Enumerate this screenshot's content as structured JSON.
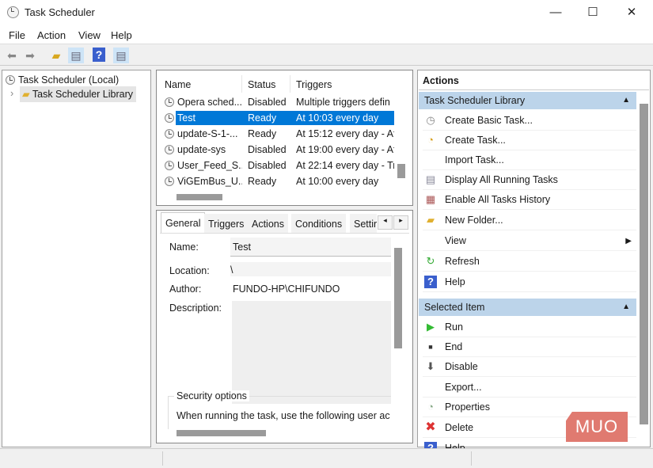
{
  "window": {
    "title": "Task Scheduler",
    "minimize": "—",
    "maximize": "☐",
    "close": "✕"
  },
  "menu": [
    "File",
    "Action",
    "View",
    "Help"
  ],
  "toolbar": [
    "back-icon",
    "forward-icon",
    "folder-up-icon",
    "show-hide-console-tree-icon",
    "help-icon",
    "show-hide-action-pane-icon"
  ],
  "tree": {
    "root": "Task Scheduler (Local)",
    "child": "Task Scheduler Library",
    "expander": "›"
  },
  "tasks": {
    "columns": [
      "Name",
      "Status",
      "Triggers"
    ],
    "rows": [
      {
        "name": "Opera sched...",
        "status": "Disabled",
        "trigger": "Multiple triggers defin"
      },
      {
        "name": "Test",
        "status": "Ready",
        "trigger": "At 10:03 every day",
        "selected": true
      },
      {
        "name": "update-S-1-...",
        "status": "Ready",
        "trigger": "At 15:12 every day - Aft"
      },
      {
        "name": "update-sys",
        "status": "Disabled",
        "trigger": "At 19:00 every day - Aft"
      },
      {
        "name": "User_Feed_S...",
        "status": "Disabled",
        "trigger": "At 22:14 every day - Trig"
      },
      {
        "name": "ViGEmBus_U...",
        "status": "Ready",
        "trigger": "At 10:00 every day"
      }
    ]
  },
  "details": {
    "tabs": [
      "General",
      "Triggers",
      "Actions",
      "Conditions",
      "Settir"
    ],
    "active_tab": "General",
    "name_label": "Name:",
    "name_value": "Test",
    "location_label": "Location:",
    "location_value": "\\",
    "author_label": "Author:",
    "author_value": "FUNDO-HP\\CHIFUNDO",
    "description_label": "Description:",
    "description_value": "",
    "security_title": "Security options",
    "security_text": "When running the task, use the following user ac"
  },
  "actions": {
    "title": "Actions",
    "groups": [
      {
        "title": "Task Scheduler Library",
        "items": [
          {
            "label": "Create Basic Task...",
            "icon": "create-basic-task-icon"
          },
          {
            "label": "Create Task...",
            "icon": "create-task-icon"
          },
          {
            "label": "Import Task...",
            "icon": ""
          },
          {
            "label": "Display All Running Tasks",
            "icon": "running-tasks-icon"
          },
          {
            "label": "Enable All Tasks History",
            "icon": "history-icon"
          },
          {
            "label": "New Folder...",
            "icon": "folder-icon"
          },
          {
            "label": "View",
            "icon": "",
            "submenu": true
          },
          {
            "label": "Refresh",
            "icon": "refresh-icon"
          },
          {
            "label": "Help",
            "icon": "help-icon"
          }
        ]
      },
      {
        "title": "Selected Item",
        "items": [
          {
            "label": "Run",
            "icon": "run-icon"
          },
          {
            "label": "End",
            "icon": "end-icon"
          },
          {
            "label": "Disable",
            "icon": "disable-icon"
          },
          {
            "label": "Export...",
            "icon": ""
          },
          {
            "label": "Properties",
            "icon": "properties-icon"
          },
          {
            "label": "Delete",
            "icon": "delete-icon"
          },
          {
            "label": "Help",
            "icon": "help-icon"
          }
        ]
      }
    ]
  },
  "watermark": "MUO",
  "colors": {
    "selection": "#0078d7",
    "group_header": "#bcd4ea",
    "watermark": "#e07a70"
  }
}
